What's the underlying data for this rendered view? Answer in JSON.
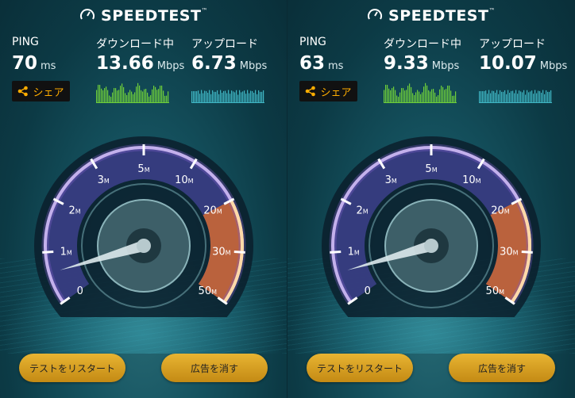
{
  "app": {
    "logo_text": "SPEEDTEST",
    "trademark": "™",
    "share_label": "シェア",
    "restart_label": "テストをリスタート",
    "remove_ads_label": "広告を消す",
    "ping_label": "PING",
    "download_label": "ダウンロード中",
    "upload_label": "アップロード",
    "ping_unit": "ms",
    "speed_unit": "Mbps"
  },
  "colors": {
    "accent_orange": "#ffad00",
    "gauge_purple": "#7d5fc8",
    "graph_green": "#6ecf3a",
    "graph_teal": "#3fb6c4"
  },
  "gauge_ticks": [
    "0",
    "1",
    "2",
    "3",
    "5",
    "10",
    "20",
    "30",
    "50"
  ],
  "gauge_unit": "M",
  "tests": [
    {
      "ping": "70",
      "download": "13.66",
      "upload": "6.73",
      "needle_value_mbps": 0.6
    },
    {
      "ping": "63",
      "download": "9.33",
      "upload": "10.07",
      "needle_value_mbps": 0.6
    }
  ]
}
